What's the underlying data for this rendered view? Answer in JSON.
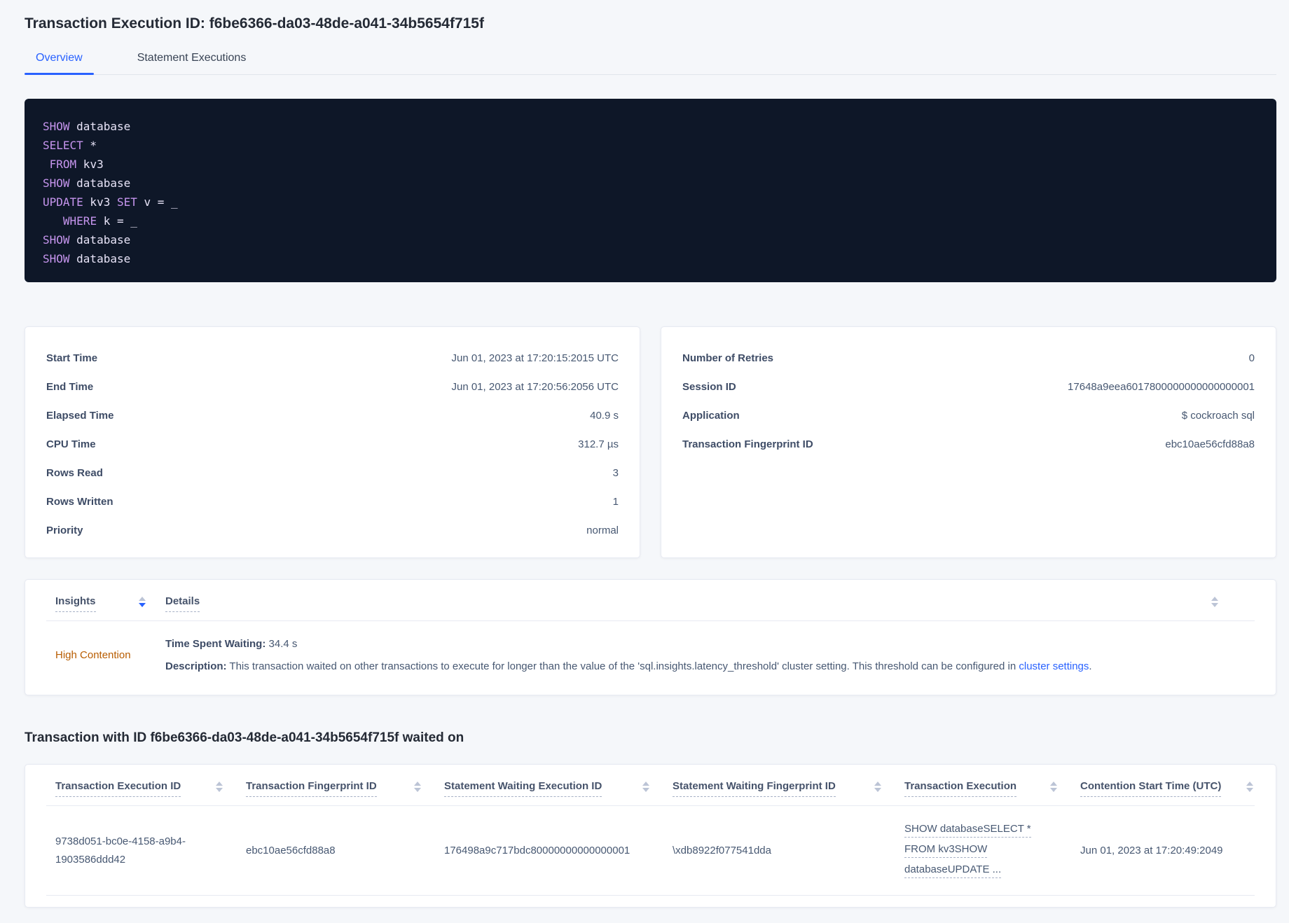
{
  "page": {
    "title": "Transaction Execution ID: f6be6366-da03-48de-a041-34b5654f715f",
    "tabs": [
      {
        "label": "Overview",
        "active": true
      },
      {
        "label": "Statement Executions",
        "active": false
      }
    ]
  },
  "sql": {
    "lines": [
      {
        "tokens": [
          {
            "t": "SHOW"
          },
          {
            "t": " database"
          }
        ]
      },
      {
        "tokens": [
          {
            "t": "SELECT"
          },
          {
            "t": " *"
          }
        ]
      },
      {
        "tokens": [
          {
            "t": " "
          },
          {
            "t": "FROM"
          },
          {
            "t": " kv3"
          }
        ]
      },
      {
        "tokens": [
          {
            "t": "SHOW"
          },
          {
            "t": " database"
          }
        ]
      },
      {
        "tokens": [
          {
            "t": "UPDATE"
          },
          {
            "t": " kv3 "
          },
          {
            "t": "SET"
          },
          {
            "t": " v = _"
          }
        ]
      },
      {
        "tokens": [
          {
            "t": "   "
          },
          {
            "t": "WHERE"
          },
          {
            "t": " k = _"
          }
        ]
      },
      {
        "tokens": [
          {
            "t": "SHOW"
          },
          {
            "t": " database"
          }
        ]
      },
      {
        "tokens": [
          {
            "t": "SHOW"
          },
          {
            "t": " database"
          }
        ]
      }
    ]
  },
  "details_left": {
    "rows": [
      {
        "label": "Start Time",
        "value": "Jun 01, 2023 at 17:20:15:2015 UTC"
      },
      {
        "label": "End Time",
        "value": "Jun 01, 2023 at 17:20:56:2056 UTC"
      },
      {
        "label": "Elapsed Time",
        "value": "40.9 s"
      },
      {
        "label": "CPU Time",
        "value": "312.7 µs"
      },
      {
        "label": "Rows Read",
        "value": "3"
      },
      {
        "label": "Rows Written",
        "value": "1"
      },
      {
        "label": "Priority",
        "value": "normal"
      }
    ]
  },
  "details_right": {
    "rows": [
      {
        "label": "Number of Retries",
        "value": "0"
      },
      {
        "label": "Session ID",
        "value": "17648a9eea6017800000000000000001"
      },
      {
        "label": "Application",
        "value": "$ cockroach sql"
      },
      {
        "label": "Transaction Fingerprint ID",
        "value": "ebc10ae56cfd88a8"
      }
    ]
  },
  "insights": {
    "columns": [
      "Insights",
      "Details"
    ],
    "row": {
      "insight": "High Contention",
      "waiting_label": "Time Spent Waiting:",
      "waiting_value": " 34.4 s",
      "description_label": "Description:",
      "description_text": " This transaction waited on other transactions to execute for longer than the value of the 'sql.insights.latency_threshold' cluster setting. This threshold can be configured in ",
      "description_link": "cluster settings",
      "description_suffix": "."
    }
  },
  "waited_on": {
    "heading": "Transaction with ID f6be6366-da03-48de-a041-34b5654f715f waited on",
    "columns": [
      "Transaction Execution ID",
      "Transaction Fingerprint ID",
      "Statement Waiting Execution ID",
      "Statement Waiting Fingerprint ID",
      "Transaction Execution",
      "Contention Start Time (UTC)"
    ],
    "row": {
      "transaction_execution_id": "9738d051-bc0e-4158-a9b4-1903586ddd42",
      "transaction_fingerprint_id": "ebc10ae56cfd88a8",
      "statement_waiting_execution_id": "176498a9c717bdc80000000000000001",
      "statement_waiting_fingerprint_id": "\\xdb8922f077541dda",
      "transaction_execution_lines": [
        "SHOW databaseSELECT *",
        "FROM kv3SHOW",
        "databaseUPDATE ..."
      ],
      "contention_start_time": "Jun 01, 2023 at 17:20:49:2049"
    }
  },
  "colors": {
    "accent_blue": "#2962ff",
    "warning_orange": "#b85c00",
    "code_background": "#0e1728",
    "code_keyword": "#c695ee",
    "code_plain": "#e8e4f8",
    "page_background": "#f5f7fa"
  }
}
